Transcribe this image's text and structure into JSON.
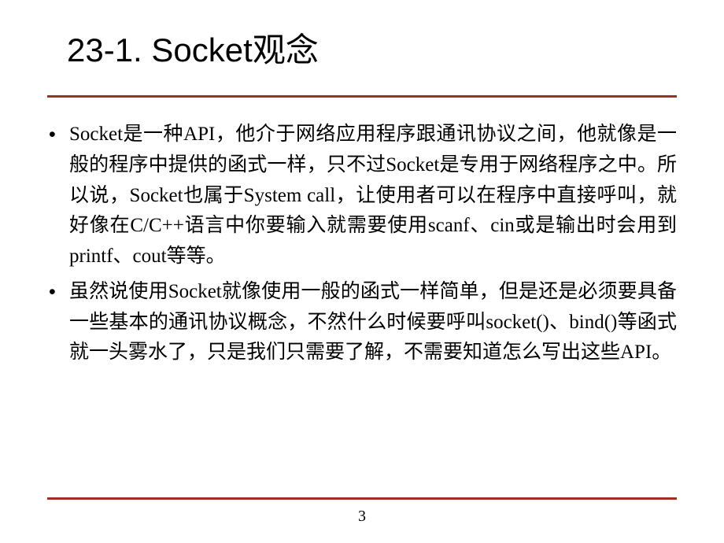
{
  "slide": {
    "title_prefix": "23-1. Socket",
    "title_suffix": "观念",
    "bullets": [
      "Socket是一种API，他介于网络应用程序跟通讯协议之间，他就像是一般的程序中提供的函式一样，只不过Socket是专用于网络程序之中。所以说，Socket也属于System call，让使用者可以在程序中直接呼叫，就好像在C/C++语言中你要输入就需要使用scanf、cin或是输出时会用到printf、cout等等。",
      "虽然说使用Socket就像使用一般的函式一样简单，但是还是必须要具备一些基本的通讯协议概念，不然什么时候要呼叫socket()、bind()等函式就一头雾水了，只是我们只需要了解，不需要知道怎么写出这些API。"
    ],
    "page_number": "3"
  }
}
